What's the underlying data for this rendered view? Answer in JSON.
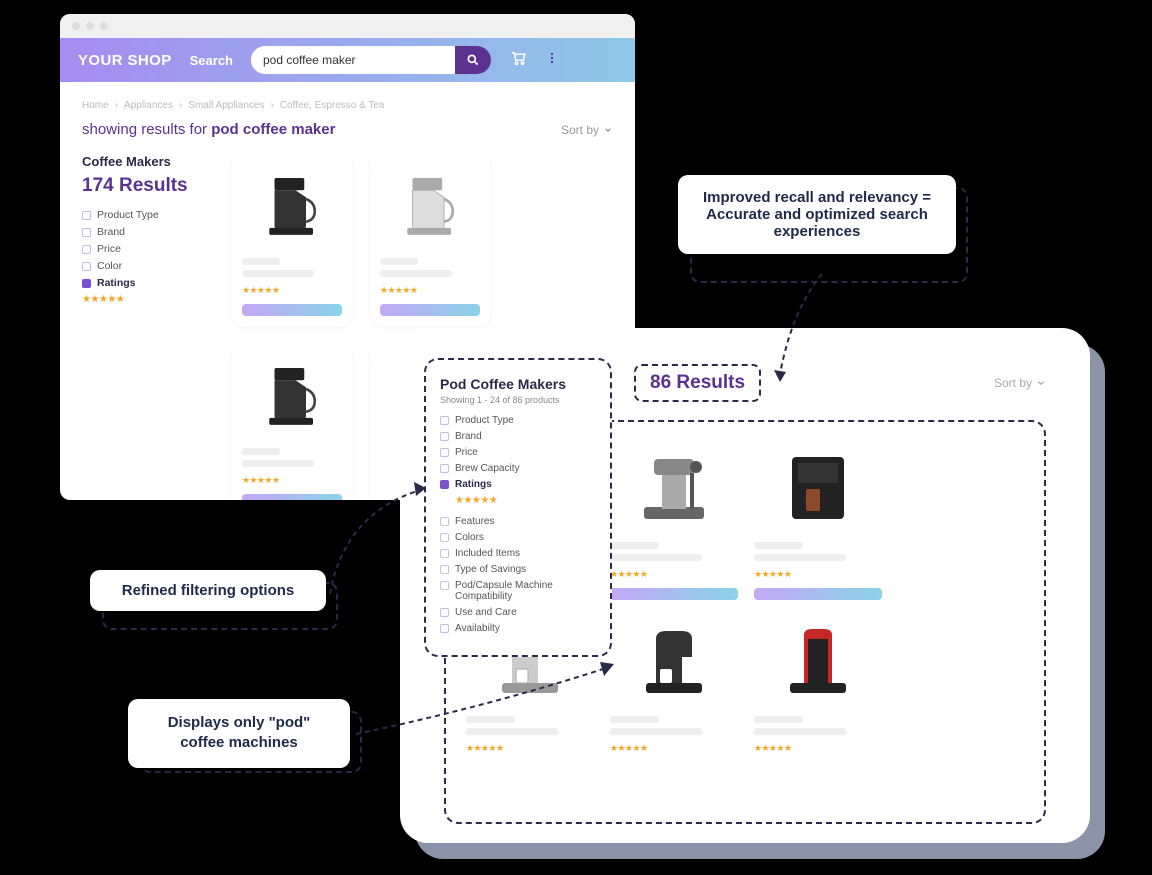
{
  "browser1": {
    "logo": "YOUR SHOP",
    "search_label": "Search",
    "search_value": "pod coffee maker",
    "breadcrumb": [
      "Home",
      "Appliances",
      "Small Appliances",
      "Coffee, Espresso & Tea"
    ],
    "showing_prefix": "showing results for ",
    "showing_query": "pod coffee maker",
    "sort_label": "Sort by",
    "category_title": "Coffee Makers",
    "results_count": "174 Results",
    "filters": [
      {
        "label": "Product Type",
        "active": false
      },
      {
        "label": "Brand",
        "active": false
      },
      {
        "label": "Price",
        "active": false
      },
      {
        "label": "Color",
        "active": false
      },
      {
        "label": "Ratings",
        "active": true
      }
    ]
  },
  "panel2": {
    "title": "Pod Coffee Makers",
    "subtitle": "Showing 1 - 24 of 86 products",
    "filters_top": [
      {
        "label": "Product Type",
        "active": false
      },
      {
        "label": "Brand",
        "active": false
      },
      {
        "label": "Price",
        "active": false
      },
      {
        "label": "Brew Capacity",
        "active": false
      },
      {
        "label": "Ratings",
        "active": true
      }
    ],
    "filters_bottom": [
      {
        "label": "Features"
      },
      {
        "label": "Colors"
      },
      {
        "label": "Included Items"
      },
      {
        "label": "Type of Savings"
      },
      {
        "label": "Pod/Capsule Machine Compatibility"
      },
      {
        "label": "Use and Care"
      },
      {
        "label": "Availabilty"
      }
    ]
  },
  "panel3": {
    "results_count": "86 Results",
    "sort_label": "Sort by"
  },
  "callouts": {
    "c1": "Improved recall and relevancy = Accurate and optimized search experiences",
    "c2": "Refined filtering options",
    "c3": "Displays only \"pod\" coffee machines"
  }
}
